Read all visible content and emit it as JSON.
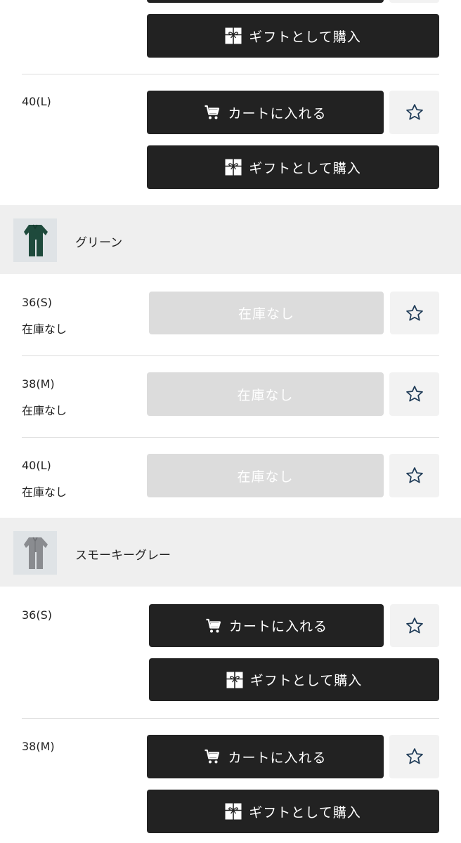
{
  "labels": {
    "cart": "カートに入れる",
    "gift": "ギフトとして購入",
    "out_of_stock": "在庫なし",
    "out_of_stock_status": "在庫なし"
  },
  "colors": {
    "button_dark": "#222222",
    "button_disabled": "#dcdcdc",
    "band_bg": "#efefef",
    "star_stroke": "#1f3b57"
  },
  "groups": [
    {
      "rows": [
        {
          "size": "40(L)"
        }
      ]
    },
    {
      "name": "グリーン",
      "rows": [
        {
          "size": "36(S)",
          "status": "在庫なし"
        },
        {
          "size": "38(M)",
          "status": "在庫なし"
        },
        {
          "size": "40(L)",
          "status": "在庫なし"
        }
      ]
    },
    {
      "name": "スモーキーグレー",
      "rows": [
        {
          "size": "36(S)"
        },
        {
          "size": "38(M)"
        }
      ]
    }
  ]
}
